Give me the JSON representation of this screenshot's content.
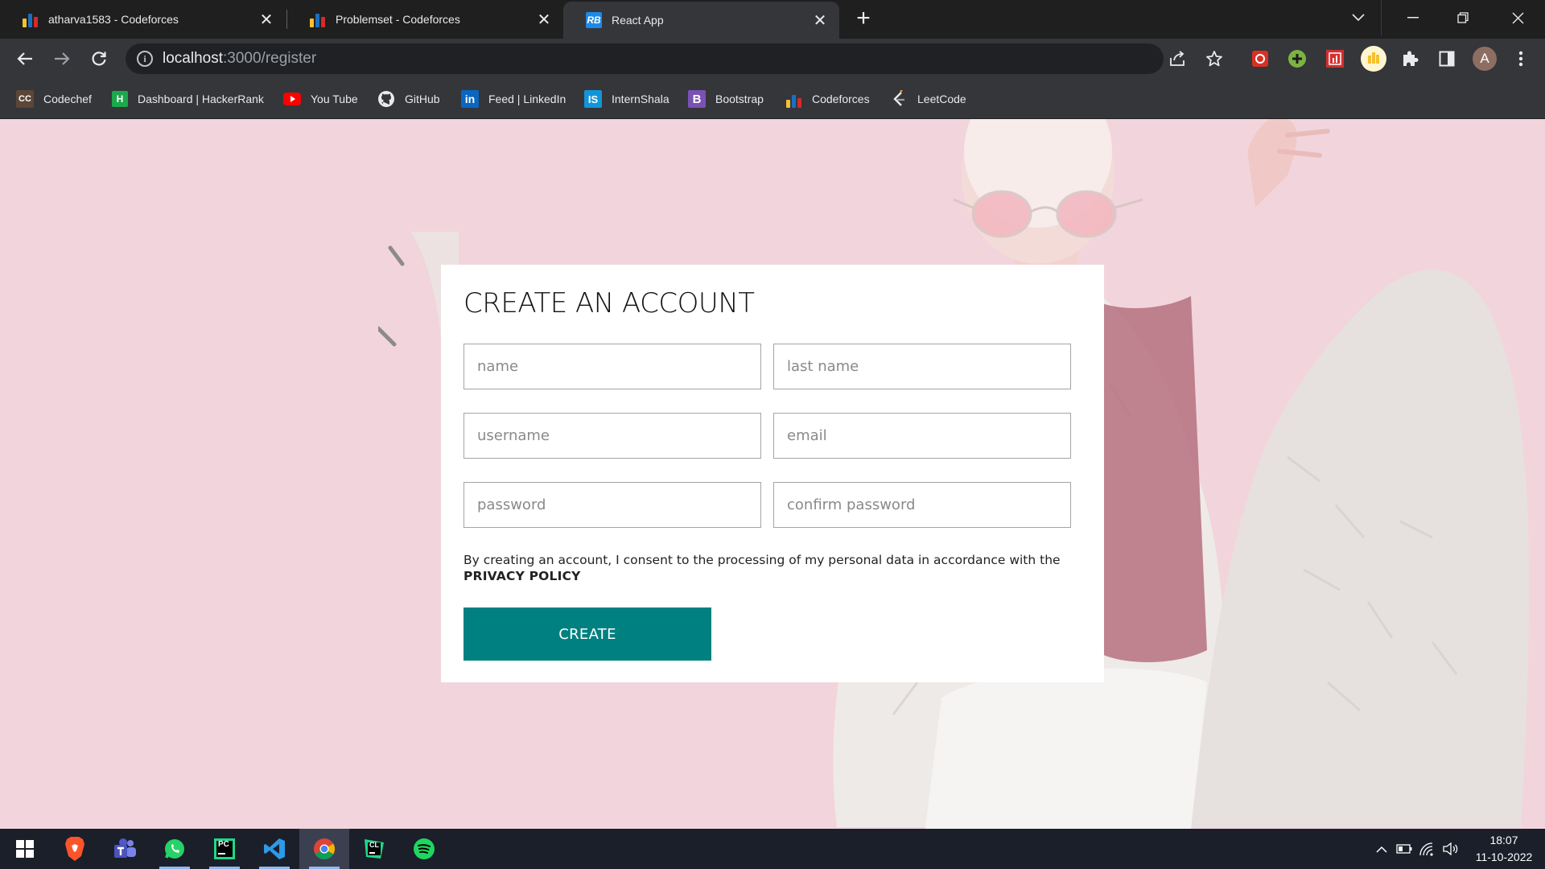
{
  "browser": {
    "tabs": [
      {
        "title": "atharva1583 - Codeforces",
        "active": false
      },
      {
        "title": "Problemset - Codeforces",
        "active": false
      },
      {
        "title": "React App",
        "active": true
      }
    ],
    "react_favicon_text": "RB",
    "url_host": "localhost",
    "url_path": ":3000/register",
    "profile_initial": "A",
    "bookmarks": [
      {
        "label": "Codechef",
        "icon": "codechef-icon"
      },
      {
        "label": "Dashboard | HackerRank",
        "icon": "hackerrank-icon"
      },
      {
        "label": "You Tube",
        "icon": "youtube-icon"
      },
      {
        "label": "GitHub",
        "icon": "github-icon"
      },
      {
        "label": "Feed | LinkedIn",
        "icon": "linkedin-icon"
      },
      {
        "label": "InternShala",
        "icon": "internshala-icon"
      },
      {
        "label": "Bootstrap",
        "icon": "bootstrap-icon"
      },
      {
        "label": "Codeforces",
        "icon": "codeforces-icon"
      },
      {
        "label": "LeetCode",
        "icon": "leetcode-icon"
      }
    ],
    "bookmark_icon_text": {
      "codechef": "CC",
      "hackerrank": "H",
      "linkedin": "in",
      "internshala": "IS",
      "bootstrap": "B"
    }
  },
  "register": {
    "title": "CREATE AN ACCOUNT",
    "fields": {
      "name": {
        "placeholder": "name",
        "value": ""
      },
      "last_name": {
        "placeholder": "last name",
        "value": ""
      },
      "username": {
        "placeholder": "username",
        "value": ""
      },
      "email": {
        "placeholder": "email",
        "value": ""
      },
      "password": {
        "placeholder": "password",
        "value": ""
      },
      "confirm_password": {
        "placeholder": "confirm password",
        "value": ""
      }
    },
    "agreement_text": "By creating an account, I consent to the processing of my personal data in accordance with the",
    "privacy_policy": "PRIVACY POLICY",
    "create_button": "CREATE"
  },
  "taskbar": {
    "apps": [
      "Brave",
      "Teams",
      "WhatsApp",
      "PyCharm",
      "VS Code",
      "Chrome",
      "CLion",
      "Spotify"
    ],
    "pycharm_label": "PC",
    "clion_label": "CL",
    "time": "18:07",
    "date": "11-10-2022"
  },
  "colors": {
    "page_background": "#f2d5dc",
    "create_button": "#008080",
    "codeforces_yellow": "#f5c02f",
    "codeforces_blue": "#1b6fc2",
    "codeforces_red": "#d52a2a"
  }
}
